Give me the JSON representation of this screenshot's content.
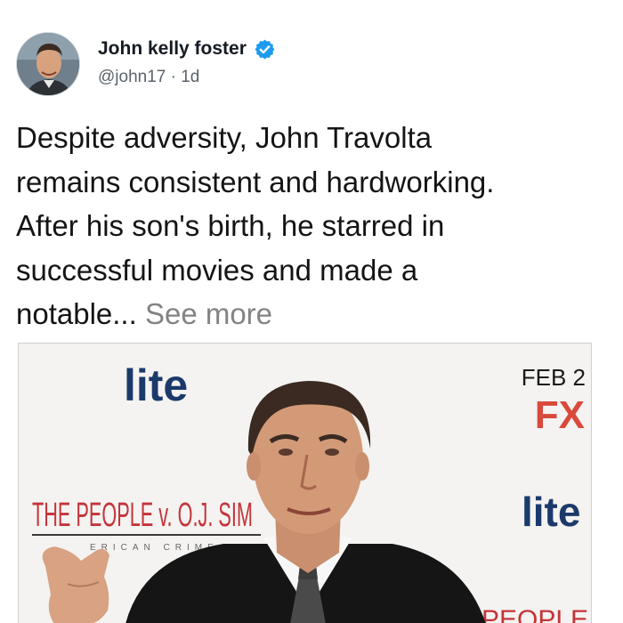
{
  "post": {
    "author_name": "John kelly foster",
    "handle": "@john17",
    "separator": "·",
    "age": "1d",
    "body": "Despite adversity, John Travolta\nremains consistent and hardworking.\nAfter his son's birth, he starred in\nsuccessful movies and made a\nnotable...",
    "see_more": "See more"
  },
  "media": {
    "backdrop_texts": {
      "logo_left": "lite",
      "date": "FEB 2",
      "network": "FX",
      "title": "THE PEOPLE v. O.J. SIM",
      "subtitle": "ERICAN CRIME ST",
      "logo_right": "lite",
      "bottom": "PEOPLE v. O.J"
    }
  },
  "colors": {
    "accent": "#1d9bf0",
    "lite_blue": "#1b3a6b",
    "fx_red": "#d84a3b",
    "title_red": "#c4343a"
  },
  "icons": [
    "verified-badge-icon"
  ]
}
